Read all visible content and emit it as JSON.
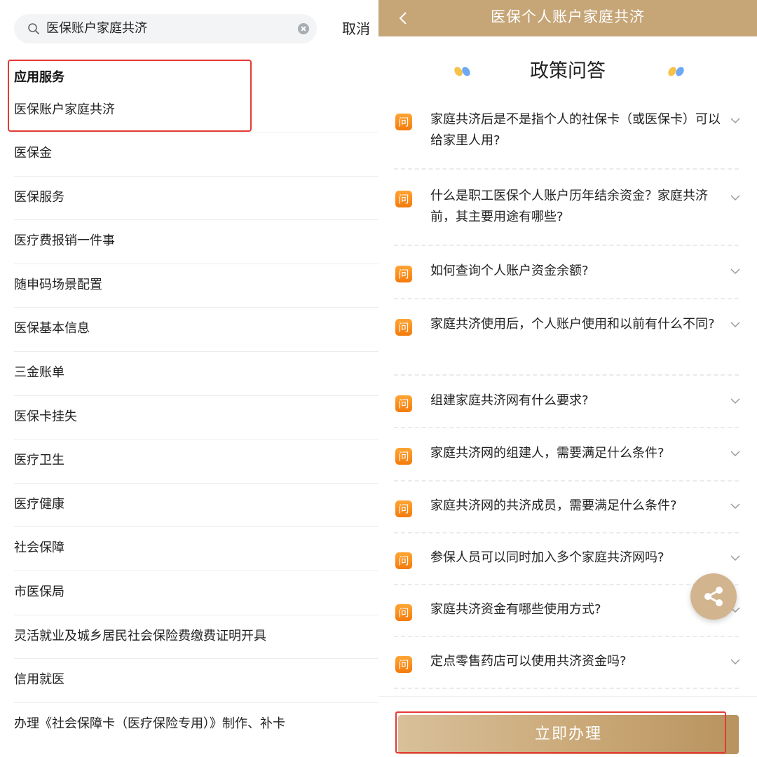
{
  "search": {
    "query": "医保账户家庭共济",
    "cancel_label": "取消"
  },
  "app_services": {
    "title": "应用服务",
    "item": "医保账户家庭共济"
  },
  "results": [
    "医保金",
    "医保服务",
    "医疗费报销一件事",
    "随申码场景配置",
    "医保基本信息",
    "三金账单",
    "医保卡挂失",
    "医疗卫生",
    "医疗健康",
    "社会保障",
    "市医保局",
    "灵活就业及城乡居民社会保险费缴费证明开具",
    "信用就医",
    "办理《社会保障卡（医疗保险专用）》制作、补卡"
  ],
  "detail": {
    "header_title": "医保个人账户家庭共济",
    "section_title": "政策问答",
    "question_badge": "问",
    "faqs": [
      "家庭共济后是不是指个人的社保卡（或医保卡）可以给家里人用?",
      "什么是职工医保个人账户历年结余资金？家庭共济前，其主要用途有哪些?",
      "如何查询个人账户资金余额?",
      "家庭共济使用后，个人账户使用和以前有什么不同?",
      "组建家庭共济网有什么要求?",
      "家庭共济网的组建人，需要满足什么条件?",
      "家庭共济网的共济成员，需要满足什么条件?",
      "参保人员可以同时加入多个家庭共济网吗?",
      "家庭共济资金有哪些使用方式?",
      "定点零售药店可以使用共济资金吗?"
    ],
    "submit_label": "立即办理"
  },
  "colors": {
    "header_bg": "#c6a577",
    "badge_orange": "#f58a1f",
    "highlight_red": "#e53935",
    "button_gold": "#caa877"
  }
}
